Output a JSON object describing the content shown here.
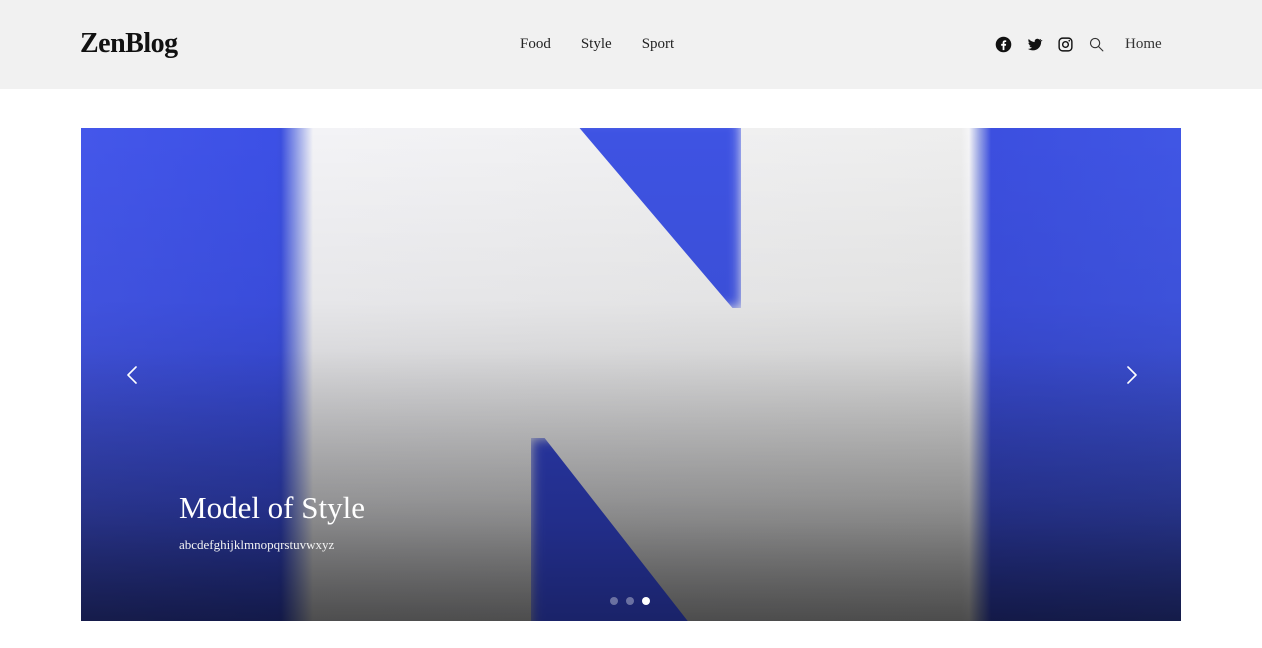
{
  "header": {
    "logo": "ZenBlog",
    "nav": [
      "Food",
      "Style",
      "Sport"
    ],
    "icons": [
      "facebook-icon",
      "twitter-icon",
      "instagram-icon",
      "search-icon"
    ],
    "home_label": "Home"
  },
  "hero": {
    "title": "Model of Style",
    "subtitle": "abcdefghijklmnopqrstuvwxyz",
    "slide_count": 3,
    "active_slide": 3,
    "arrows": [
      "chevron-left-icon",
      "chevron-right-icon"
    ]
  },
  "colors": {
    "header_bg": "#f1f1f1",
    "hero_blue": "#3c50e6",
    "hero_light": "#eeeeee",
    "text_dark": "#111111",
    "caption_text": "#ffffff"
  }
}
